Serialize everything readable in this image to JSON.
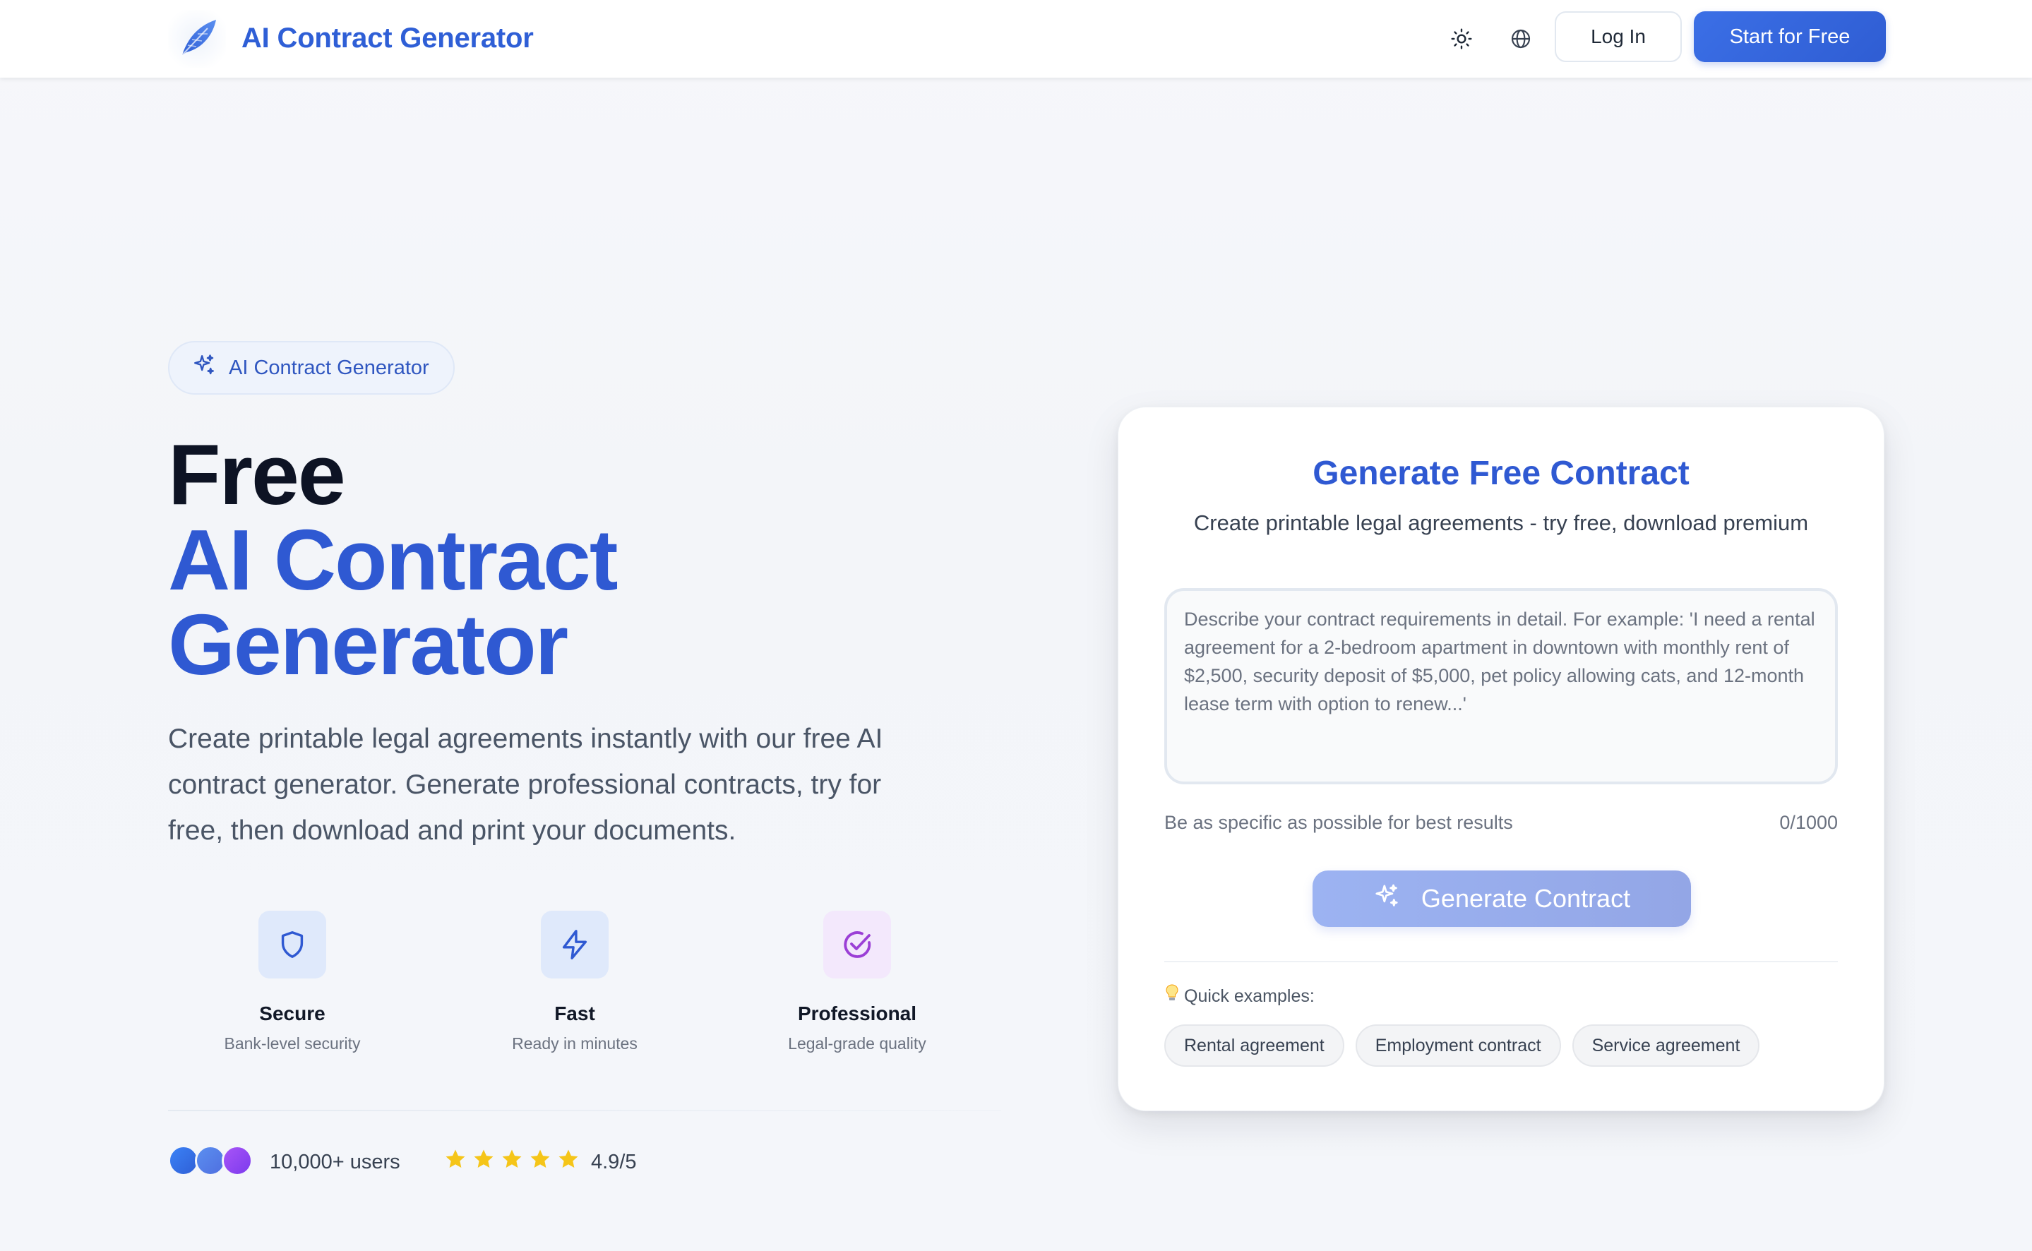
{
  "header": {
    "brand": "AI Contract Generator",
    "icons": {
      "logo": "feather-icon",
      "theme": "sun-icon",
      "language": "globe-icon"
    },
    "login_label": "Log In",
    "start_label": "Start for Free"
  },
  "hero": {
    "badge": "AI Contract Generator",
    "title_line1": "Free",
    "title_line2": "AI Contract",
    "title_line3": "Generator",
    "lead": "Create printable legal agreements instantly with our free AI contract generator. Generate professional contracts, try for free, then download and print your documents.",
    "features": [
      {
        "title": "Secure",
        "subtitle": "Bank-level security",
        "icon": "shield-icon"
      },
      {
        "title": "Fast",
        "subtitle": "Ready in minutes",
        "icon": "lightning-icon"
      },
      {
        "title": "Professional",
        "subtitle": "Legal-grade quality",
        "icon": "check-circle-icon"
      }
    ],
    "users": "10,000+ users",
    "stars": 5,
    "rating": "4.9/5"
  },
  "form": {
    "title": "Generate Free Contract",
    "subtitle": "Create printable legal agreements - try free, download premium",
    "placeholder": "Describe your contract requirements in detail. For example: 'I need a rental agreement for a 2-bedroom apartment in downtown with monthly rent of $2,500, security deposit of $5,000, pet policy allowing cats, and 12-month lease term with option to renew...'",
    "value": "",
    "hint": "Be as specific as possible for best results",
    "count": "0/1000",
    "button_label": "Generate Contract",
    "examples_label": "Quick examples:",
    "examples": [
      "Rental agreement",
      "Employment contract",
      "Service agreement"
    ]
  },
  "colors": {
    "brand": "#2f59d2",
    "primary_button": "#3b6fe6",
    "disabled_button": "#9cb3f2",
    "star": "#f5c518"
  }
}
